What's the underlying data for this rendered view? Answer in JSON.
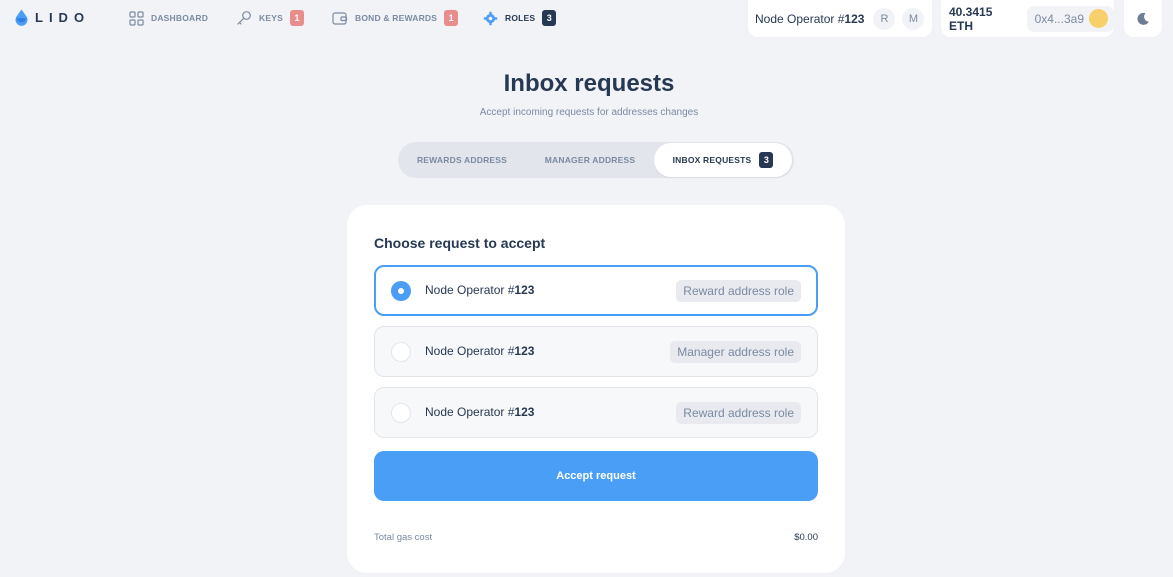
{
  "nav": {
    "logo_text": "LIDO",
    "links": [
      {
        "label": "DASHBOARD",
        "icon": "grid-icon"
      },
      {
        "label": "KEYS",
        "icon": "key-icon",
        "badge": "1"
      },
      {
        "label": "BOND & REWARDS",
        "icon": "wallet-icon",
        "badge": "1"
      },
      {
        "label": "ROLES",
        "icon": "gear-icon",
        "badge": "3",
        "active": true
      }
    ],
    "operator": {
      "prefix": "Node Operator #",
      "number": "123",
      "roles": [
        "R",
        "M"
      ]
    },
    "wallet": {
      "balance": "40.3415 ETH",
      "address": "0x4...3a9"
    },
    "theme_toggle_icon": "moon-icon"
  },
  "header": {
    "title": "Inbox requests",
    "subtitle": "Accept incoming requests for addresses changes"
  },
  "tabs": [
    {
      "label": "REWARDS ADDRESS"
    },
    {
      "label": "MANAGER ADDRESS"
    },
    {
      "label": "INBOX REQUESTS",
      "badge": "3",
      "active": true
    }
  ],
  "card": {
    "title": "Choose request to accept",
    "options": [
      {
        "prefix": "Node Operator #",
        "number": "123",
        "role": "Reward address role",
        "selected": true
      },
      {
        "prefix": "Node Operator #",
        "number": "123",
        "role": "Manager address role",
        "selected": false
      },
      {
        "prefix": "Node Operator #",
        "number": "123",
        "role": "Reward address role",
        "selected": false
      }
    ],
    "accept_label": "Accept request",
    "gas_label": "Total gas cost",
    "gas_value": "$0.00"
  },
  "colors": {
    "background": "#f2f3f7",
    "accent": "#4b9ef5",
    "text": "#273852",
    "muted": "#7a8aa0",
    "badge_red": "#e98c8c",
    "avatar": "#f7d06b"
  }
}
